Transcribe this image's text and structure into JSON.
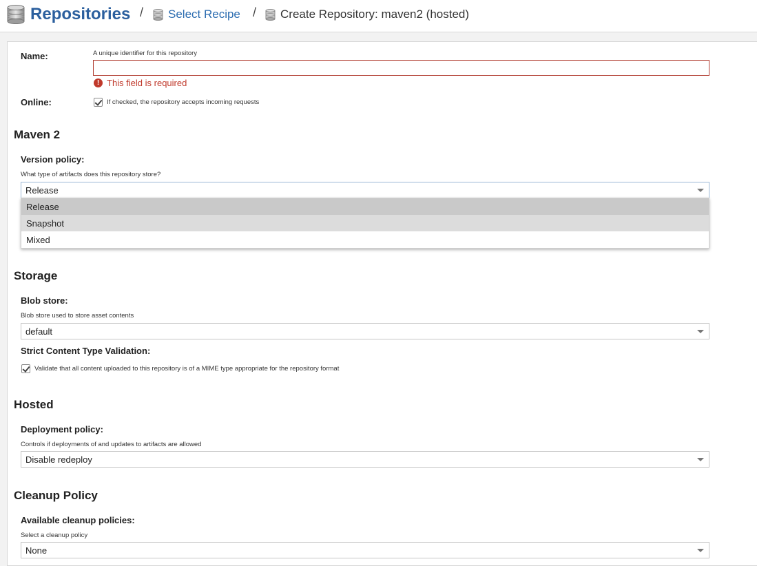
{
  "breadcrumb": {
    "root": "Repositories",
    "separator": "/",
    "recipe": "Select Recipe",
    "current": "Create Repository: maven2 (hosted)"
  },
  "form": {
    "name": {
      "label": "Name:",
      "help": "A unique identifier for this repository",
      "value": "",
      "error": "This field is required"
    },
    "online": {
      "label": "Online:",
      "checked": true,
      "help": "If checked, the repository accepts incoming requests"
    },
    "maven": {
      "heading": "Maven 2",
      "version_policy": {
        "label": "Version policy:",
        "help": "What type of artifacts does this repository store?",
        "value": "Release",
        "options": [
          "Release",
          "Snapshot",
          "Mixed"
        ],
        "selected_option": "Release",
        "hovered_option": "Snapshot"
      }
    },
    "storage": {
      "heading": "Storage",
      "blob_store": {
        "label": "Blob store:",
        "help": "Blob store used to store asset contents",
        "value": "default"
      },
      "strict_validation": {
        "label": "Strict Content Type Validation:",
        "checked": true,
        "help": "Validate that all content uploaded to this repository is of a MIME type appropriate for the repository format"
      }
    },
    "hosted": {
      "heading": "Hosted",
      "deployment_policy": {
        "label": "Deployment policy:",
        "help": "Controls if deployments of and updates to artifacts are allowed",
        "value": "Disable redeploy"
      }
    },
    "cleanup": {
      "heading": "Cleanup Policy",
      "policies": {
        "label": "Available cleanup policies:",
        "help": "Select a cleanup policy",
        "value": "None"
      }
    }
  },
  "colors": {
    "link": "#2b6cb0",
    "error": "#c0392b",
    "selected_option": "#c9c9c9"
  }
}
